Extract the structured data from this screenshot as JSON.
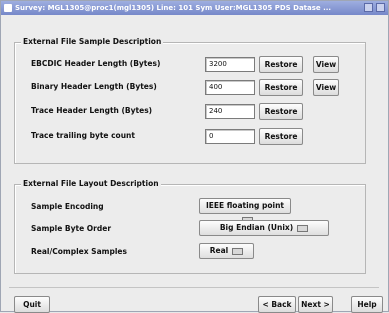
{
  "window": {
    "title": "Survey: MGL1305@proc1(mgl1305) Line: 101 Sym User:MGL1305  PDS Datase ..."
  },
  "sample_group": {
    "title": "External File Sample Description",
    "rows": [
      {
        "label": "EBCDIC Header Length (Bytes)",
        "value": "3200",
        "restore": "Restore",
        "view": "View"
      },
      {
        "label": "Binary Header Length (Bytes)",
        "value": "400",
        "restore": "Restore",
        "view": "View"
      },
      {
        "label": "Trace Header Length (Bytes)",
        "value": "240",
        "restore": "Restore"
      },
      {
        "label": "Trace trailing byte count",
        "value": "0",
        "restore": "Restore"
      }
    ]
  },
  "layout_group": {
    "title": "External File Layout Description",
    "rows": [
      {
        "label": "Sample Encoding",
        "value": "IEEE floating point"
      },
      {
        "label": "Sample Byte Order",
        "value": "Big Endian (Unix)"
      },
      {
        "label": "Real/Complex Samples",
        "value": "Real"
      }
    ]
  },
  "footer": {
    "quit": "Quit",
    "back": "< Back",
    "next": "Next >",
    "help": "Help"
  },
  "colors": {
    "titlebar": "#7688c9",
    "background": "#ececec"
  },
  "icons": [
    "app-icon",
    "minimize-icon",
    "close-icon",
    "dropdown-indicator-icon"
  ]
}
